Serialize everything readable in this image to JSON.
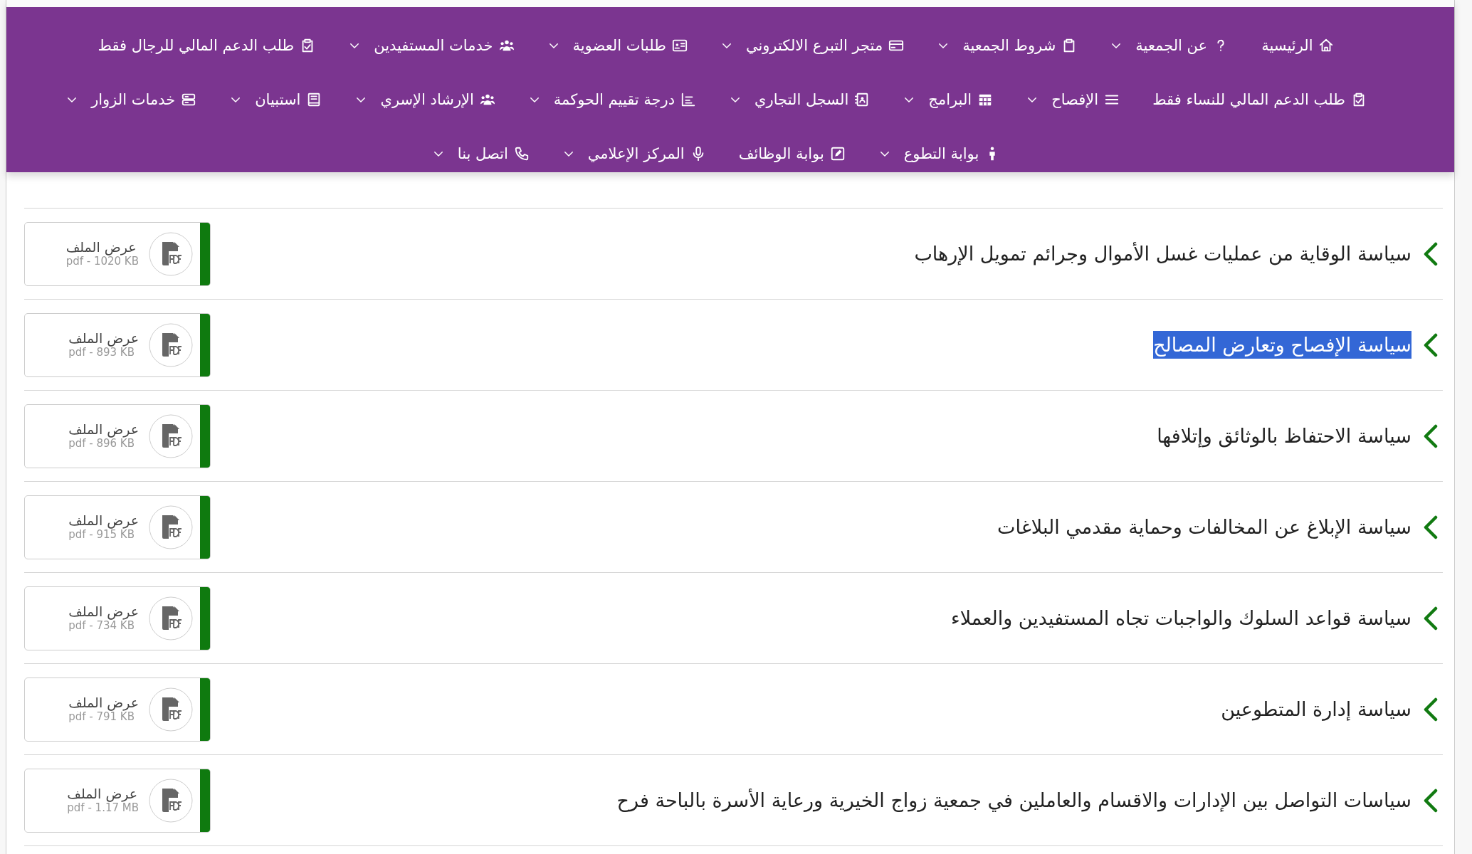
{
  "menu_rows": [
    [
      {
        "label": "الرئيسية",
        "dropdown": false
      },
      {
        "label": "عن الجمعية",
        "dropdown": true
      },
      {
        "label": "شروط الجمعية",
        "dropdown": true
      },
      {
        "label": "متجر التبرع الالكتروني",
        "dropdown": true
      },
      {
        "label": "طلبات العضوية",
        "dropdown": true
      },
      {
        "label": "خدمات المستفيدين",
        "dropdown": true
      },
      {
        "label": "طلب الدعم المالي للرجال فقط",
        "dropdown": false
      }
    ],
    [
      {
        "label": "طلب الدعم المالي للنساء فقط",
        "dropdown": false
      },
      {
        "label": "الإفصاح",
        "dropdown": true
      },
      {
        "label": "البرامج",
        "dropdown": true
      },
      {
        "label": "السجل التجاري",
        "dropdown": true
      },
      {
        "label": "درجة تقييم الحوكمة",
        "dropdown": true
      },
      {
        "label": "الإرشاد الإسري",
        "dropdown": true
      },
      {
        "label": "استبيان",
        "dropdown": true
      },
      {
        "label": "خدمات الزوار",
        "dropdown": true
      }
    ],
    [
      {
        "label": "بوابة التطوع",
        "dropdown": true
      },
      {
        "label": "بوابة الوظائف",
        "dropdown": false
      },
      {
        "label": "المركز الإعلامي",
        "dropdown": true
      },
      {
        "label": "اتصل بنا",
        "dropdown": true
      }
    ]
  ],
  "policies": [
    {
      "title": "سياسة الوقاية من عمليات غسل الأموال وجرائم تمويل الإرهاب",
      "highlighted": false,
      "file_label": "عرض الملف",
      "file_info": "pdf - 1020 KB"
    },
    {
      "title": "سياسة الإفصاح وتعارض المصالح",
      "highlighted": true,
      "file_label": "عرض الملف",
      "file_info": "pdf - 893 KB"
    },
    {
      "title": "سياسة الاحتفاظ بالوثائق وإتلافها",
      "highlighted": false,
      "file_label": "عرض الملف",
      "file_info": "pdf - 896 KB"
    },
    {
      "title": "سياسة الإبلاغ عن المخالفات وحماية مقدمي البلاغات",
      "highlighted": false,
      "file_label": "عرض الملف",
      "file_info": "pdf - 915 KB"
    },
    {
      "title": "سياسة قواعد السلوك والواجبات تجاه المستفيدين والعملاء",
      "highlighted": false,
      "file_label": "عرض الملف",
      "file_info": "pdf - 734 KB"
    },
    {
      "title": "سياسة إدارة المتطوعين",
      "highlighted": false,
      "file_label": "عرض الملف",
      "file_info": "pdf - 791 KB"
    },
    {
      "title": "سياسات التواصل بين الإدارات والاقسام والعاملين في جمعية زواج الخيرية ورعاية الأسرة بالباحة فرح",
      "highlighted": false,
      "file_label": "عرض الملف",
      "file_info": "pdf - 1.17 MB"
    }
  ]
}
